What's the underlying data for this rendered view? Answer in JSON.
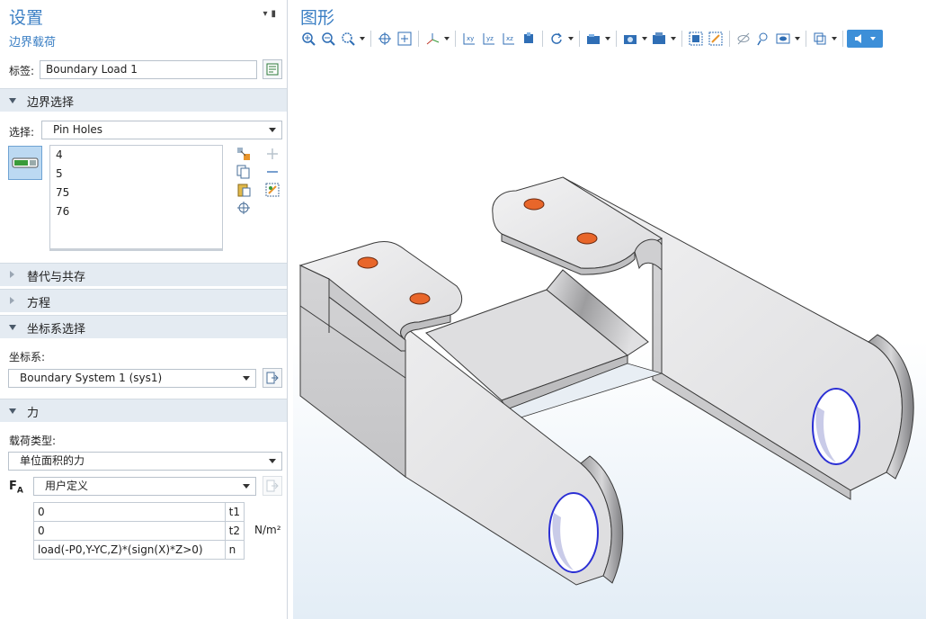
{
  "panel": {
    "title": "设置",
    "subtitle": "边界载荷",
    "label_caption": "标签:",
    "label_value": "Boundary Load 1"
  },
  "sections": {
    "boundary_selection": "边界选择",
    "override": "替代与共存",
    "equation": "方程",
    "coord_selection": "坐标系选择",
    "force": "力"
  },
  "selection": {
    "caption": "选择:",
    "value": "Pin Holes",
    "items": [
      "4",
      "5",
      "75",
      "76"
    ]
  },
  "coordinate": {
    "caption": "坐标系:",
    "value": "Boundary System 1 (sys1)"
  },
  "load": {
    "type_caption": "载荷类型:",
    "type_value": "单位面积的力",
    "fa_symbol": "F",
    "fa_subscript": "A",
    "fa_value": "用户定义",
    "unit": "N/m²",
    "components": [
      {
        "value": "0",
        "comp": "t1"
      },
      {
        "value": "0",
        "comp": "t2"
      },
      {
        "value": "load(-P0,Y-YC,Z)*(sign(X)*Z>0)",
        "comp": "n"
      }
    ]
  },
  "graphics": {
    "title": "图形",
    "toolbar_icons": [
      "zoom-in-icon",
      "zoom-out-icon",
      "zoom-box-icon",
      "center-icon",
      "zoom-extents-icon",
      "axis-orientation-icon",
      "view-xy-icon",
      "view-yz-icon",
      "view-zx-icon",
      "view-3d-icon",
      "rotate-icon",
      "scene-light-icon",
      "screenshot-icon",
      "render-icon",
      "select-boxes-icon",
      "deselect-icon",
      "hide-icon",
      "hide-selection-icon",
      "view-icon",
      "transparency-icon",
      "sound-icon"
    ]
  },
  "colors": {
    "accent": "#3b7fc4",
    "section_bg": "#e4ebf2",
    "highlight_face": "#e8662a",
    "edge_selection": "#2b2fd4"
  }
}
